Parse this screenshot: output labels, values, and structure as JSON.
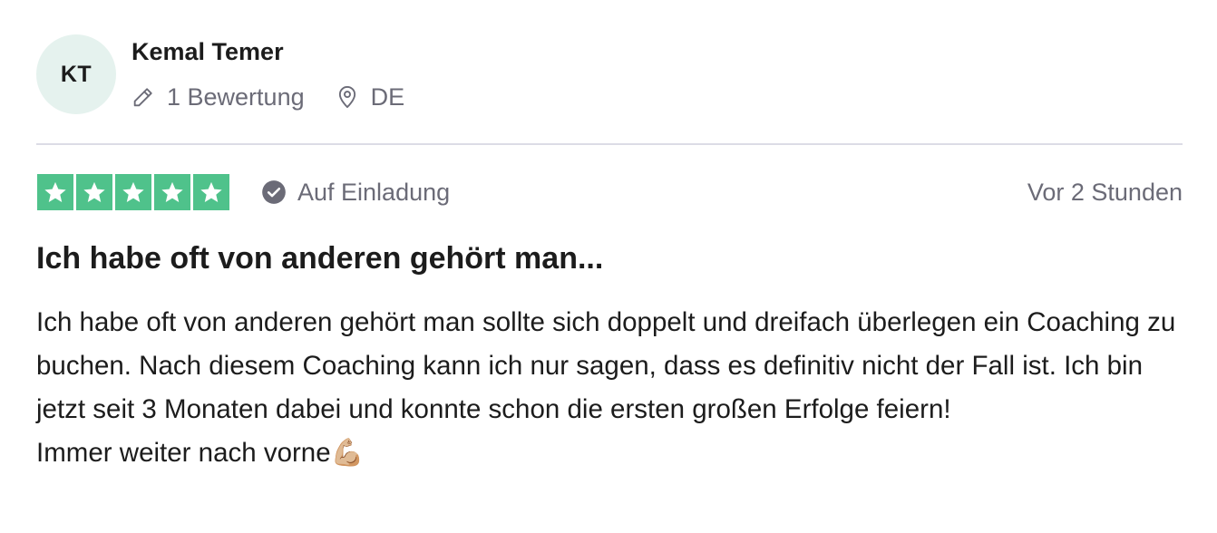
{
  "consumer": {
    "initials": "KT",
    "name": "Kemal Temer",
    "review_count": "1 Bewertung",
    "country": "DE",
    "icons": [
      "pencil-icon",
      "location-pin-icon"
    ],
    "avatar_color": "#e5f2ee"
  },
  "review": {
    "rating": 5,
    "max_rating": 5,
    "star_color": "#4fc28b",
    "verification_label": "Auf Einladung",
    "verification_icon": "check-circle-icon",
    "date": "Vor 2 Stunden",
    "title": "Ich habe oft von anderen gehört man...",
    "body": "Ich habe oft von anderen gehört man sollte sich doppelt und dreifach überlegen ein Coaching zu buchen. Nach diesem Coaching kann ich nur sagen, dass es definitiv nicht der Fall ist. Ich bin jetzt seit 3 Monaten dabei und konnte schon die ersten großen Erfolge feiern!",
    "body_last_line": "Immer weiter nach vorne💪🏼"
  }
}
